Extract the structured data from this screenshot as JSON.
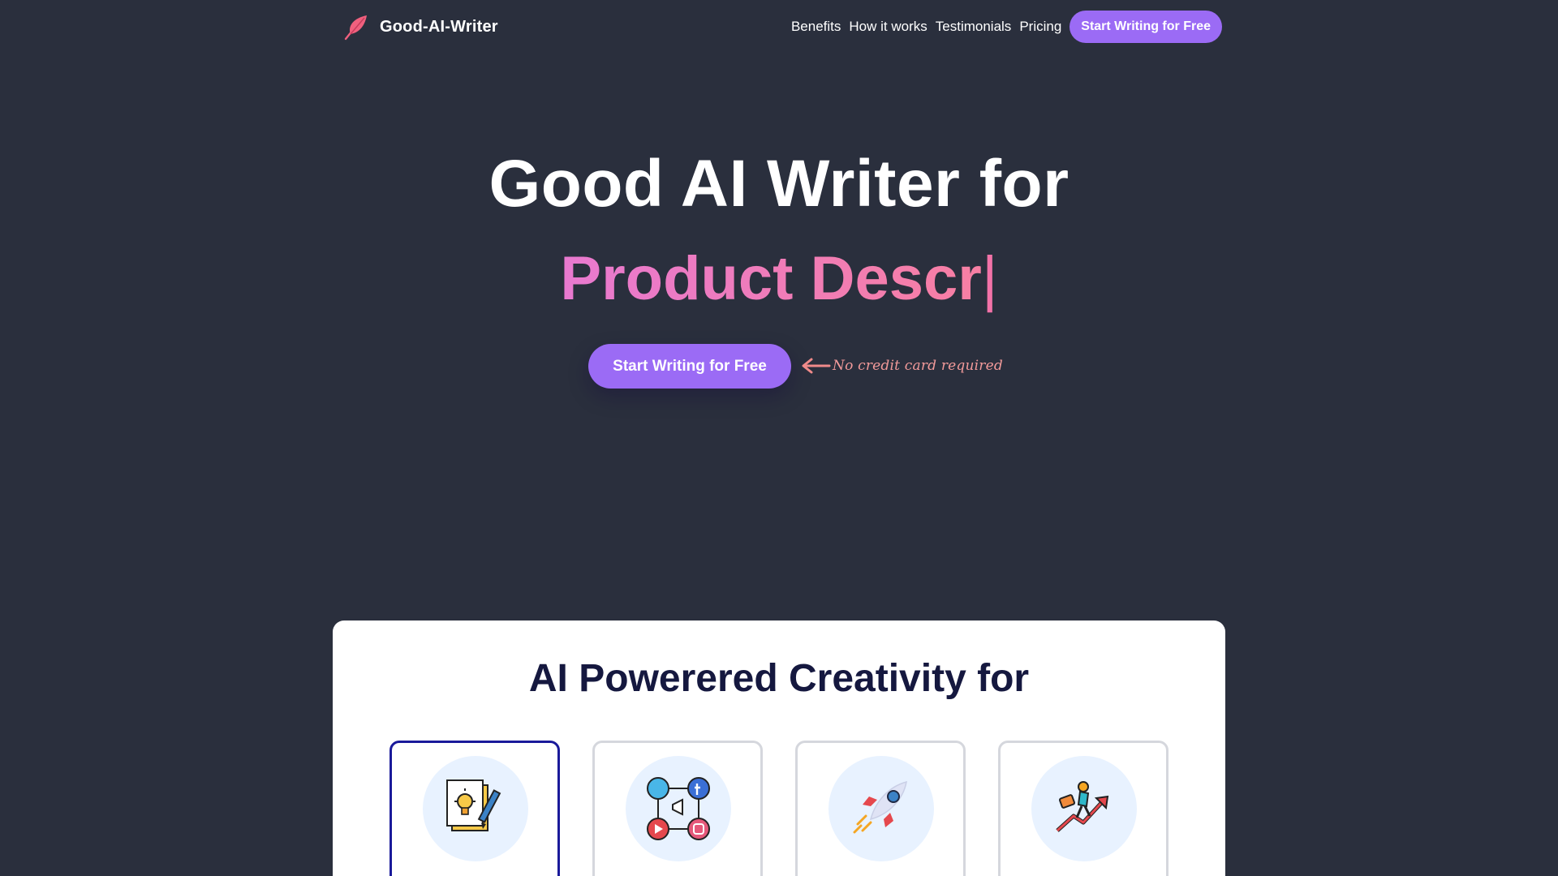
{
  "nav": {
    "brand_name": "Good-AI-Writer",
    "brand_icon": "feather-icon",
    "links": [
      "Benefits",
      "How it works",
      "Testimonials",
      "Pricing"
    ],
    "cta_label": "Start Writing for Free"
  },
  "hero": {
    "title": "Good AI Writer for",
    "typed_text": "Product Descr",
    "caret": "|",
    "cta_label": "Start Writing for Free",
    "note": "No credit card required"
  },
  "features": {
    "title": "AI Powerered Creativity for",
    "tiles": [
      {
        "icon": "idea-writing-icon"
      },
      {
        "icon": "social-media-icon"
      },
      {
        "icon": "rocket-icon"
      },
      {
        "icon": "growth-chart-icon"
      }
    ]
  },
  "colors": {
    "background": "#2a2f3d",
    "accent": "#9b6bf5",
    "pink": "#f17ab8",
    "panel_title": "#15183f",
    "active_border": "#1a1a9a"
  }
}
